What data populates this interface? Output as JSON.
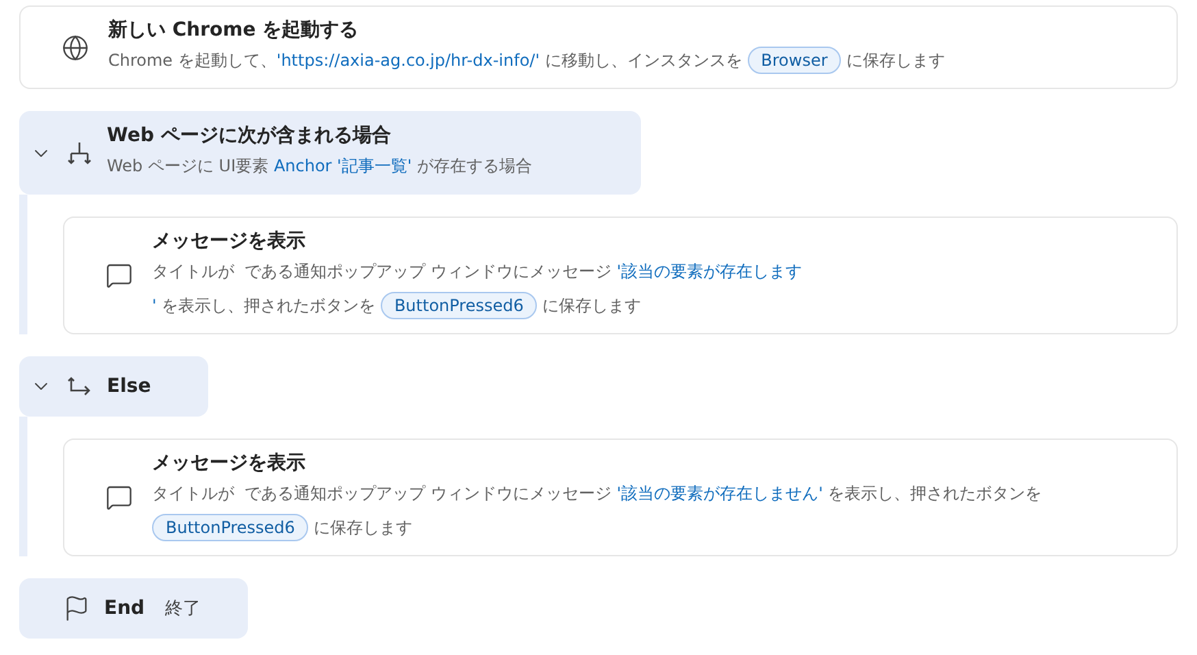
{
  "steps": [
    {
      "kind": "browser_action",
      "title": "新しい Chrome を起動する",
      "description": [
        {
          "kind": "text",
          "text": "Chrome を起動して、"
        },
        {
          "kind": "value",
          "text": "'https://axia-ag.co.jp/hr-dx-info/'"
        },
        {
          "kind": "text",
          "text": " に移動し、インスタンスを "
        },
        {
          "kind": "variable",
          "text": "Browser"
        },
        {
          "kind": "text",
          "text": " に保存します"
        }
      ]
    },
    {
      "kind": "condition",
      "expanded": true,
      "title": "Web ページに次が含まれる場合",
      "description": [
        {
          "kind": "text",
          "text": "Web ページに UI要素 "
        },
        {
          "kind": "value",
          "text": "Anchor '記事一覧'"
        },
        {
          "kind": "text",
          "text": " が存在する場合"
        }
      ],
      "children": [
        {
          "kind": "message_action",
          "title": "メッセージを表示",
          "description": [
            {
              "kind": "text",
              "text": "タイトルが  である通知ポップアップ ウィンドウにメッセージ "
            },
            {
              "kind": "value",
              "text": "'該当の要素が存在します"
            },
            {
              "kind": "break"
            },
            {
              "kind": "value",
              "text": "'"
            },
            {
              "kind": "text",
              "text": " を表示し、押されたボタンを "
            },
            {
              "kind": "variable",
              "text": "ButtonPressed6"
            },
            {
              "kind": "text",
              "text": " に保存します"
            }
          ]
        }
      ]
    },
    {
      "kind": "else",
      "expanded": true,
      "title": "Else",
      "children": [
        {
          "kind": "message_action",
          "title": "メッセージを表示",
          "description": [
            {
              "kind": "text",
              "text": "タイトルが  である通知ポップアップ ウィンドウにメッセージ "
            },
            {
              "kind": "value",
              "text": "'該当の要素が存在しません'"
            },
            {
              "kind": "text",
              "text": " を表示し、押されたボタンを "
            },
            {
              "kind": "variable",
              "text": "ButtonPressed6"
            },
            {
              "kind": "text",
              "text": " に保存します"
            }
          ]
        }
      ]
    },
    {
      "kind": "end",
      "title": "End",
      "subtitle": "終了"
    }
  ]
}
